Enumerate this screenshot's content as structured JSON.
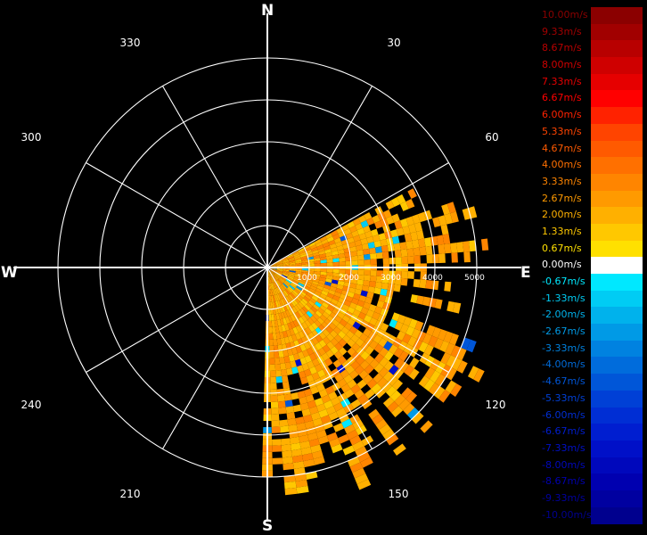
{
  "compass": {
    "north": "N",
    "south": "S",
    "east": "E",
    "west": "W"
  },
  "angle_labels": [
    "30",
    "60",
    "120",
    "150",
    "210",
    "240",
    "300",
    "330"
  ],
  "range_labels": [
    "1000",
    "2000",
    "3000",
    "4000",
    "5000"
  ],
  "colors": {
    "background": "#000000",
    "grid": "#ffffff"
  },
  "colorbar": {
    "entries": [
      {
        "label": "10.00m/s",
        "color": "#8b0000"
      },
      {
        "label": "9.33m/s",
        "color": "#a10000"
      },
      {
        "label": "8.67m/s",
        "color": "#b80000"
      },
      {
        "label": "8.00m/s",
        "color": "#cf0000"
      },
      {
        "label": "7.33m/s",
        "color": "#e60000"
      },
      {
        "label": "6.67m/s",
        "color": "#ff0000"
      },
      {
        "label": "6.00m/s",
        "color": "#ff2200"
      },
      {
        "label": "5.33m/s",
        "color": "#ff4400"
      },
      {
        "label": "4.67m/s",
        "color": "#ff5a00"
      },
      {
        "label": "4.00m/s",
        "color": "#ff7000"
      },
      {
        "label": "3.33m/s",
        "color": "#ff8500"
      },
      {
        "label": "2.67m/s",
        "color": "#ff9a00"
      },
      {
        "label": "2.00m/s",
        "color": "#ffb000"
      },
      {
        "label": "1.33m/s",
        "color": "#ffc800"
      },
      {
        "label": "0.67m/s",
        "color": "#ffe000"
      },
      {
        "label": "0.00m/s",
        "color": "#ffffff"
      },
      {
        "label": "-0.67m/s",
        "color": "#00e8ff"
      },
      {
        "label": "-1.33m/s",
        "color": "#00ccf4"
      },
      {
        "label": "-2.00m/s",
        "color": "#00b2ec"
      },
      {
        "label": "-2.67m/s",
        "color": "#009ae6"
      },
      {
        "label": "-3.33m/s",
        "color": "#0082e0"
      },
      {
        "label": "-4.00m/s",
        "color": "#006cdc"
      },
      {
        "label": "-4.67m/s",
        "color": "#0056d8"
      },
      {
        "label": "-5.33m/s",
        "color": "#0040d6"
      },
      {
        "label": "-6.00m/s",
        "color": "#002ed4"
      },
      {
        "label": "-6.67m/s",
        "color": "#001ed0"
      },
      {
        "label": "-7.33m/s",
        "color": "#0010c8"
      },
      {
        "label": "-8.00m/s",
        "color": "#0008bc"
      },
      {
        "label": "-8.67m/s",
        "color": "#0000b0"
      },
      {
        "label": "-9.33m/s",
        "color": "#0000a0"
      },
      {
        "label": "-10.00m/s",
        "color": "#00008e"
      }
    ]
  }
}
